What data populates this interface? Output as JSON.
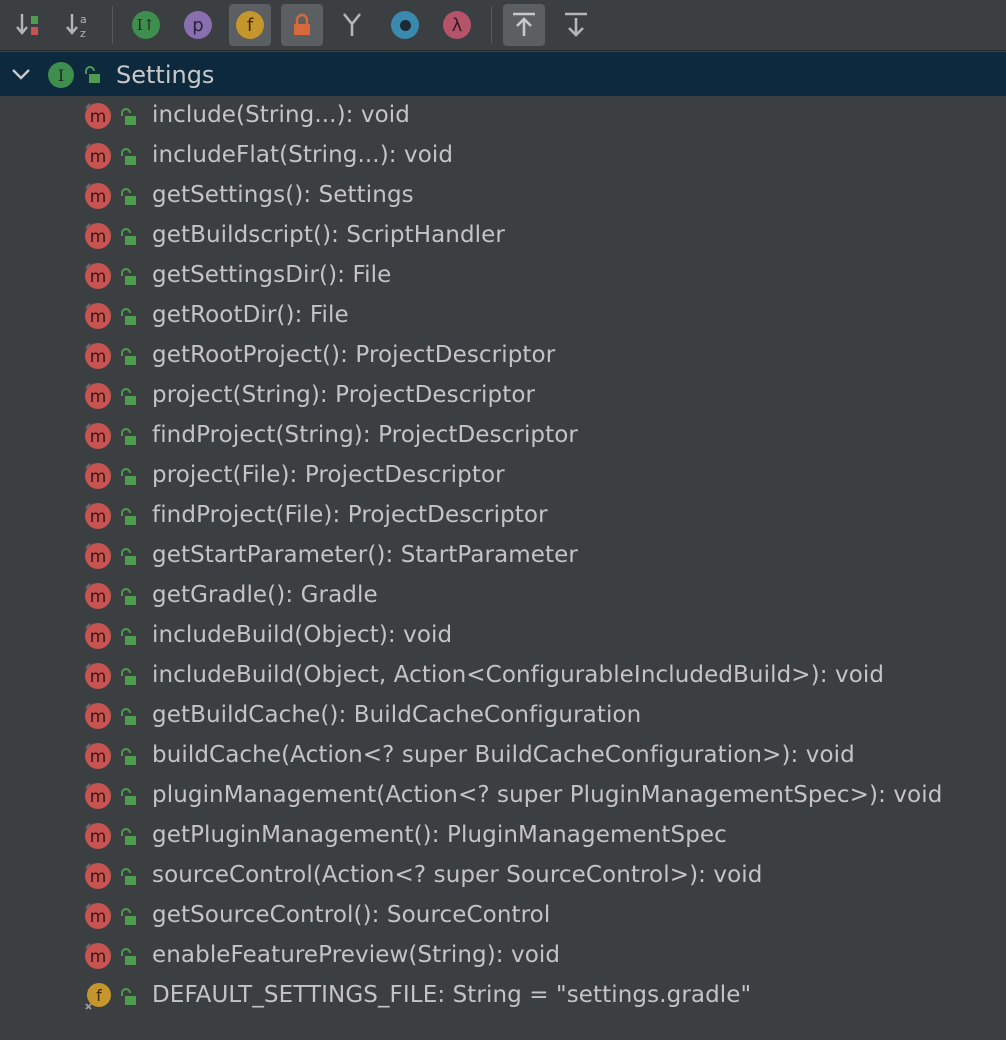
{
  "toolbar": {
    "buttons": [
      {
        "name": "sort-by-visibility-button",
        "active": false
      },
      {
        "name": "sort-alphabetically-button",
        "active": false
      },
      {
        "name": "show-inherited-button",
        "active": false,
        "glyph": "I"
      },
      {
        "name": "show-properties-button",
        "active": false,
        "glyph": "p"
      },
      {
        "name": "show-fields-button",
        "active": true,
        "glyph": "f"
      },
      {
        "name": "show-non-public-button",
        "active": true
      },
      {
        "name": "show-inherited-hierarchy-button",
        "active": false
      },
      {
        "name": "show-anonymous-classes-button",
        "active": false
      },
      {
        "name": "show-lambdas-button",
        "active": false,
        "glyph": "λ"
      },
      {
        "name": "autoscroll-to-source-button",
        "active": true
      },
      {
        "name": "autoscroll-from-source-button",
        "active": false
      }
    ]
  },
  "tree": {
    "root": {
      "label": "Settings",
      "icon": "interface-icon",
      "expanded": true
    },
    "items": [
      {
        "kind": "method",
        "label": "include(String...): void"
      },
      {
        "kind": "method",
        "label": "includeFlat(String...): void"
      },
      {
        "kind": "method",
        "label": "getSettings(): Settings"
      },
      {
        "kind": "method",
        "label": "getBuildscript(): ScriptHandler"
      },
      {
        "kind": "method",
        "label": "getSettingsDir(): File"
      },
      {
        "kind": "method",
        "label": "getRootDir(): File"
      },
      {
        "kind": "method",
        "label": "getRootProject(): ProjectDescriptor"
      },
      {
        "kind": "method",
        "label": "project(String): ProjectDescriptor"
      },
      {
        "kind": "method",
        "label": "findProject(String): ProjectDescriptor"
      },
      {
        "kind": "method",
        "label": "project(File): ProjectDescriptor"
      },
      {
        "kind": "method",
        "label": "findProject(File): ProjectDescriptor"
      },
      {
        "kind": "method",
        "label": "getStartParameter(): StartParameter"
      },
      {
        "kind": "method",
        "label": "getGradle(): Gradle"
      },
      {
        "kind": "method",
        "label": "includeBuild(Object): void"
      },
      {
        "kind": "method",
        "label": "includeBuild(Object, Action<ConfigurableIncludedBuild>): void"
      },
      {
        "kind": "method",
        "label": "getBuildCache(): BuildCacheConfiguration"
      },
      {
        "kind": "method",
        "label": "buildCache(Action<? super BuildCacheConfiguration>): void"
      },
      {
        "kind": "method",
        "label": "pluginManagement(Action<? super PluginManagementSpec>): void"
      },
      {
        "kind": "method",
        "label": "getPluginManagement(): PluginManagementSpec"
      },
      {
        "kind": "method",
        "label": "sourceControl(Action<? super SourceControl>): void"
      },
      {
        "kind": "method",
        "label": "getSourceControl(): SourceControl"
      },
      {
        "kind": "method",
        "label": "enableFeaturePreview(String): void"
      },
      {
        "kind": "field",
        "label": "DEFAULT_SETTINGS_FILE: String = \"settings.gradle\""
      }
    ]
  },
  "colors": {
    "background": "#3c3f41",
    "selection": "#0d293e",
    "method_icon": "#c75450",
    "field_icon": "#c4962c",
    "interface_icon": "#3e8e4e",
    "lock_green": "#4f9b50"
  }
}
